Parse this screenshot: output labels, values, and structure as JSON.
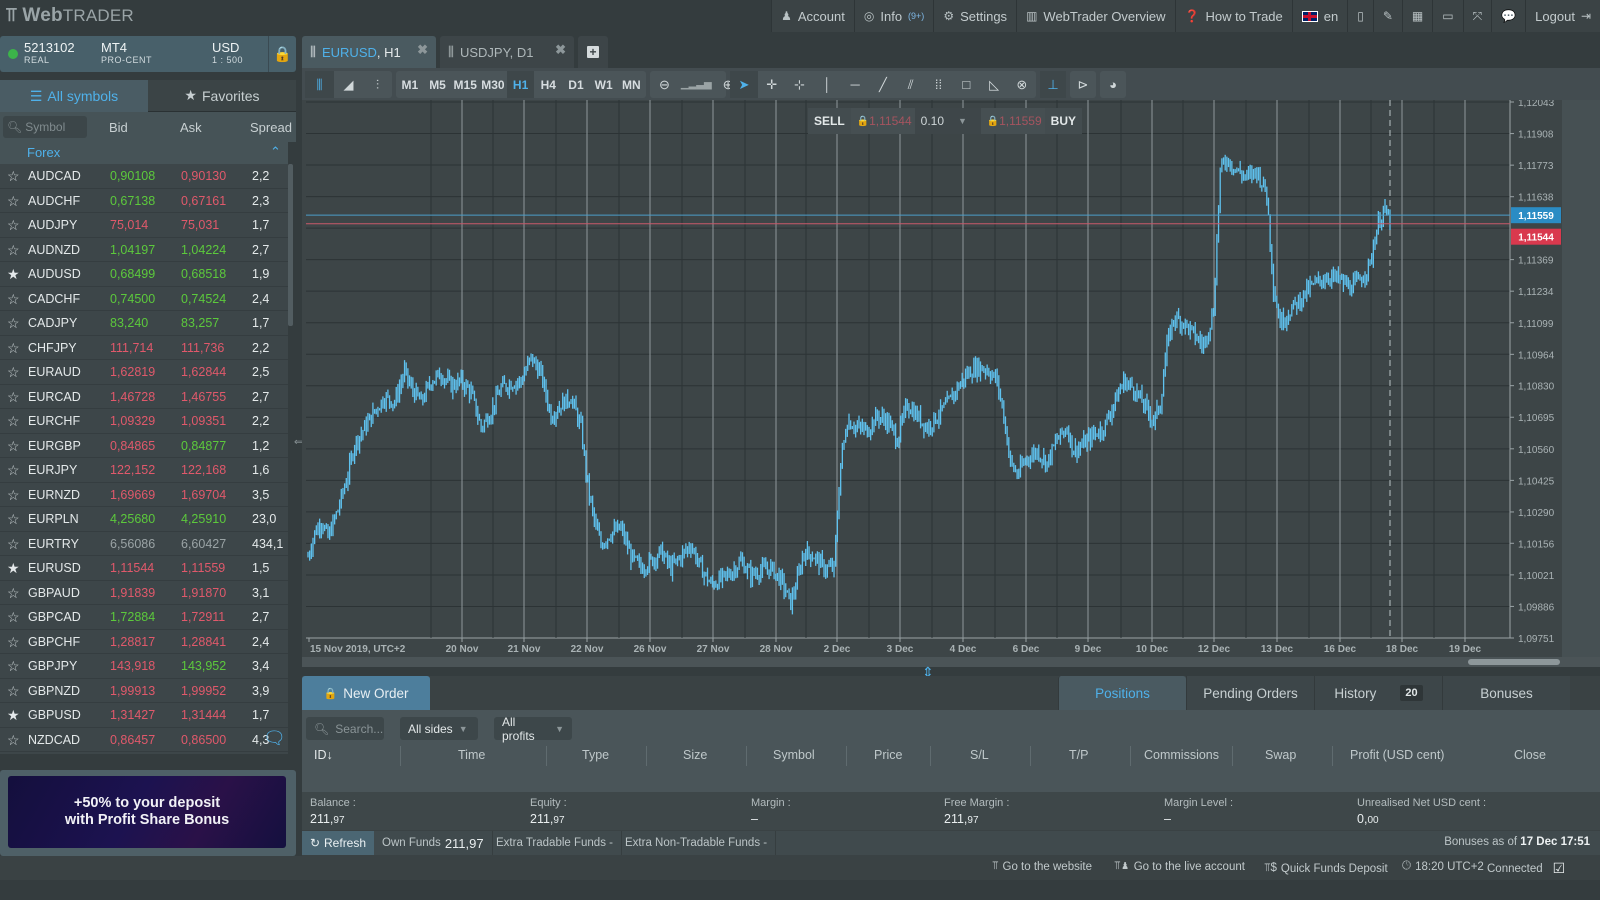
{
  "app": {
    "logo_bold": "Web",
    "logo_light": "TRADER"
  },
  "topmenu": [
    {
      "icon": "user-icon",
      "glyph": "♟",
      "label": "Account"
    },
    {
      "icon": "lifebuoy-icon",
      "glyph": "◎",
      "label": "Info",
      "badge": "(9+)"
    },
    {
      "icon": "gears-icon",
      "glyph": "⚙",
      "label": "Settings"
    },
    {
      "icon": "book-icon",
      "glyph": "▥",
      "label": "WebTrader Overview"
    },
    {
      "icon": "question-icon",
      "glyph": "❓",
      "label": "How to Trade"
    },
    {
      "icon": "uk-flag-icon",
      "glyph": "",
      "label": "en"
    },
    {
      "icon": "mobile-icon",
      "glyph": "▯",
      "label": ""
    },
    {
      "icon": "brush-icon",
      "glyph": "✎",
      "label": ""
    },
    {
      "icon": "grid-icon",
      "glyph": "▦",
      "label": ""
    },
    {
      "icon": "window-icon",
      "glyph": "▭",
      "label": ""
    },
    {
      "icon": "fullscreen-icon",
      "glyph": "⤧",
      "label": ""
    },
    {
      "icon": "chat-icon",
      "glyph": "💬",
      "label": ""
    },
    {
      "icon": "logout-icon",
      "glyph": "⇥",
      "label": "Logout"
    }
  ],
  "account": {
    "number": "5213102",
    "type": "REAL",
    "platform": "MT4",
    "subtype": "PRO-CENT",
    "currency": "USD",
    "leverage": "1 : 500",
    "status_color": "#3cb44a"
  },
  "symbols_panel": {
    "tabs": [
      {
        "label": "All symbols",
        "active": true
      },
      {
        "label": "Favorites",
        "active": false
      }
    ],
    "search_placeholder": "Symbol",
    "columns": [
      "Bid",
      "Ask",
      "Spread"
    ],
    "group": "Forex",
    "rows": [
      {
        "symbol": "AUDCAD",
        "bid": "0,90108",
        "ask": "0,90130",
        "spread": "2,2",
        "fav": false,
        "bid_dir": "up",
        "ask_dir": "dn"
      },
      {
        "symbol": "AUDCHF",
        "bid": "0,67138",
        "ask": "0,67161",
        "spread": "2,3",
        "fav": false,
        "bid_dir": "up",
        "ask_dir": "dn"
      },
      {
        "symbol": "AUDJPY",
        "bid": "75,014",
        "ask": "75,031",
        "spread": "1,7",
        "fav": false,
        "bid_dir": "dn",
        "ask_dir": "dn"
      },
      {
        "symbol": "AUDNZD",
        "bid": "1,04197",
        "ask": "1,04224",
        "spread": "2,7",
        "fav": false,
        "bid_dir": "up",
        "ask_dir": "up"
      },
      {
        "symbol": "AUDUSD",
        "bid": "0,68499",
        "ask": "0,68518",
        "spread": "1,9",
        "fav": true,
        "bid_dir": "up",
        "ask_dir": "up"
      },
      {
        "symbol": "CADCHF",
        "bid": "0,74500",
        "ask": "0,74524",
        "spread": "2,4",
        "fav": false,
        "bid_dir": "up",
        "ask_dir": "up"
      },
      {
        "symbol": "CADJPY",
        "bid": "83,240",
        "ask": "83,257",
        "spread": "1,7",
        "fav": false,
        "bid_dir": "up",
        "ask_dir": "up"
      },
      {
        "symbol": "CHFJPY",
        "bid": "111,714",
        "ask": "111,736",
        "spread": "2,2",
        "fav": false,
        "bid_dir": "dn",
        "ask_dir": "dn"
      },
      {
        "symbol": "EURAUD",
        "bid": "1,62819",
        "ask": "1,62844",
        "spread": "2,5",
        "fav": false,
        "bid_dir": "dn",
        "ask_dir": "dn"
      },
      {
        "symbol": "EURCAD",
        "bid": "1,46728",
        "ask": "1,46755",
        "spread": "2,7",
        "fav": false,
        "bid_dir": "dn",
        "ask_dir": "dn"
      },
      {
        "symbol": "EURCHF",
        "bid": "1,09329",
        "ask": "1,09351",
        "spread": "2,2",
        "fav": false,
        "bid_dir": "dn",
        "ask_dir": "dn"
      },
      {
        "symbol": "EURGBP",
        "bid": "0,84865",
        "ask": "0,84877",
        "spread": "1,2",
        "fav": false,
        "bid_dir": "dn",
        "ask_dir": "up"
      },
      {
        "symbol": "EURJPY",
        "bid": "122,152",
        "ask": "122,168",
        "spread": "1,6",
        "fav": false,
        "bid_dir": "dn",
        "ask_dir": "dn"
      },
      {
        "symbol": "EURNZD",
        "bid": "1,69669",
        "ask": "1,69704",
        "spread": "3,5",
        "fav": false,
        "bid_dir": "dn",
        "ask_dir": "dn"
      },
      {
        "symbol": "EURPLN",
        "bid": "4,25680",
        "ask": "4,25910",
        "spread": "23,0",
        "fav": false,
        "bid_dir": "up",
        "ask_dir": "up"
      },
      {
        "symbol": "EURTRY",
        "bid": "6,56086",
        "ask": "6,60427",
        "spread": "434,1",
        "fav": false,
        "bid_dir": "gr",
        "ask_dir": "gr"
      },
      {
        "symbol": "EURUSD",
        "bid": "1,11544",
        "ask": "1,11559",
        "spread": "1,5",
        "fav": true,
        "bid_dir": "dn",
        "ask_dir": "dn"
      },
      {
        "symbol": "GBPAUD",
        "bid": "1,91839",
        "ask": "1,91870",
        "spread": "3,1",
        "fav": false,
        "bid_dir": "dn",
        "ask_dir": "dn"
      },
      {
        "symbol": "GBPCAD",
        "bid": "1,72884",
        "ask": "1,72911",
        "spread": "2,7",
        "fav": false,
        "bid_dir": "up",
        "ask_dir": "dn"
      },
      {
        "symbol": "GBPCHF",
        "bid": "1,28817",
        "ask": "1,28841",
        "spread": "2,4",
        "fav": false,
        "bid_dir": "dn",
        "ask_dir": "dn"
      },
      {
        "symbol": "GBPJPY",
        "bid": "143,918",
        "ask": "143,952",
        "spread": "3,4",
        "fav": false,
        "bid_dir": "dn",
        "ask_dir": "up"
      },
      {
        "symbol": "GBPNZD",
        "bid": "1,99913",
        "ask": "1,99952",
        "spread": "3,9",
        "fav": false,
        "bid_dir": "dn",
        "ask_dir": "dn"
      },
      {
        "symbol": "GBPUSD",
        "bid": "1,31427",
        "ask": "1,31444",
        "spread": "1,7",
        "fav": true,
        "bid_dir": "dn",
        "ask_dir": "dn"
      },
      {
        "symbol": "NZDCAD",
        "bid": "0,86457",
        "ask": "0,86500",
        "spread": "4,3",
        "fav": false,
        "bid_dir": "dn",
        "ask_dir": "dn"
      }
    ],
    "banner_line1": "+50% to your deposit",
    "banner_line2": "with Profit Share Bonus"
  },
  "chart_tabs": [
    {
      "symbol": "EURUSD",
      "tf": "H1",
      "active": true
    },
    {
      "symbol": "USDJPY",
      "tf": "D1",
      "active": false
    }
  ],
  "chart_toolbar": {
    "chart_types": [
      "bars-icon",
      "area-icon",
      "ohlc-icon"
    ],
    "timeframes": [
      "M1",
      "M5",
      "M15",
      "M30",
      "H1",
      "H4",
      "D1",
      "W1",
      "MN"
    ],
    "active_timeframe": "H1",
    "tools": [
      "cursor-icon",
      "crosshair-icon",
      "crosshair-box-icon",
      "vertical-line-icon",
      "horizontal-line-icon",
      "trend-line-icon",
      "fibonacci-fan-icon",
      "fibonacci-grid-icon",
      "rectangle-icon",
      "triangle-icon",
      "delete-drawings-icon",
      "period-separator-icon",
      "chart-shift-icon",
      "indicators-icon"
    ]
  },
  "trade_box": {
    "sell_label": "SELL",
    "sell_price": "1,11544",
    "volume": "0.10",
    "buy_price": "1,11559",
    "buy_label": "BUY"
  },
  "chart_data": {
    "type": "ohlc",
    "symbol": "EURUSD",
    "timeframe": "H1",
    "y_ticks": [
      "1,12043",
      "1,11908",
      "1,11773",
      "1,11638",
      "1,11369",
      "1,11234",
      "1,11099",
      "1,10964",
      "1,10830",
      "1,10695",
      "1,10560",
      "1,10425",
      "1,10290",
      "1,10156",
      "1,10021",
      "1,09886",
      "1,09751"
    ],
    "ylim": [
      1.09751,
      1.12043
    ],
    "x_ticks": [
      "15 Nov 2019, UTC+2",
      "20 Nov",
      "21 Nov",
      "22 Nov",
      "26 Nov",
      "27 Nov",
      "28 Nov",
      "2 Dec",
      "3 Dec",
      "4 Dec",
      "6 Dec",
      "9 Dec",
      "10 Dec",
      "12 Dec",
      "13 Dec",
      "16 Dec",
      "18 Dec",
      "19 Dec"
    ],
    "ask_price": 1.11559,
    "bid_price": 1.11544,
    "ask_label": "1,11559",
    "bid_label": "1,11544",
    "ask_color": "#2b8cc4",
    "bid_color": "#d9394e",
    "series_color": "#5fc2ef",
    "close_path": [
      [
        0,
        1.101
      ],
      [
        2,
        1.102
      ],
      [
        4,
        1.1025
      ],
      [
        6,
        1.1018
      ],
      [
        9,
        1.103
      ],
      [
        12,
        1.1045
      ],
      [
        14,
        1.1058
      ],
      [
        17,
        1.1065
      ],
      [
        20,
        1.1072
      ],
      [
        23,
        1.1078
      ],
      [
        26,
        1.1076
      ],
      [
        29,
        1.1089
      ],
      [
        31,
        1.1082
      ],
      [
        34,
        1.1076
      ],
      [
        37,
        1.1085
      ],
      [
        40,
        1.1088
      ],
      [
        43,
        1.1083
      ],
      [
        46,
        1.1085
      ],
      [
        49,
        1.108
      ],
      [
        52,
        1.1065
      ],
      [
        55,
        1.1072
      ],
      [
        58,
        1.1082
      ],
      [
        61,
        1.1084
      ],
      [
        64,
        1.1085
      ],
      [
        67,
        1.1095
      ],
      [
        70,
        1.1088
      ],
      [
        73,
        1.107
      ],
      [
        76,
        1.1075
      ],
      [
        79,
        1.1078
      ],
      [
        82,
        1.1065
      ],
      [
        84,
        1.104
      ],
      [
        86,
        1.1025
      ],
      [
        88,
        1.1015
      ],
      [
        91,
        1.102
      ],
      [
        94,
        1.1022
      ],
      [
        97,
        1.101
      ],
      [
        100,
        1.1005
      ],
      [
        103,
        1.1008
      ],
      [
        106,
        1.1012
      ],
      [
        109,
        1.1005
      ],
      [
        112,
        1.101
      ],
      [
        115,
        1.1015
      ],
      [
        118,
        1.1005
      ],
      [
        121,
        1.0998
      ],
      [
        124,
        1.1
      ],
      [
        127,
        1.1003
      ],
      [
        130,
        1.1008
      ],
      [
        133,
        1.1002
      ],
      [
        136,
        1.1004
      ],
      [
        139,
        1.1005
      ],
      [
        142,
        1.1
      ],
      [
        145,
        1.099
      ],
      [
        147,
        1.1
      ],
      [
        149,
        1.1012
      ],
      [
        152,
        1.101
      ],
      [
        155,
        1.1005
      ],
      [
        158,
        1.1005
      ],
      [
        160,
        1.105
      ],
      [
        162,
        1.1068
      ],
      [
        165,
        1.1065
      ],
      [
        168,
        1.1064
      ],
      [
        171,
        1.107
      ],
      [
        174,
        1.1068
      ],
      [
        177,
        1.106
      ],
      [
        180,
        1.1075
      ],
      [
        183,
        1.107
      ],
      [
        186,
        1.1065
      ],
      [
        189,
        1.107
      ],
      [
        192,
        1.1075
      ],
      [
        195,
        1.1082
      ],
      [
        198,
        1.1088
      ],
      [
        201,
        1.1091
      ],
      [
        204,
        1.109
      ],
      [
        207,
        1.1085
      ],
      [
        209,
        1.107
      ],
      [
        211,
        1.105
      ],
      [
        213,
        1.1045
      ],
      [
        216,
        1.1052
      ],
      [
        219,
        1.1055
      ],
      [
        222,
        1.105
      ],
      [
        225,
        1.106
      ],
      [
        228,
        1.1065
      ],
      [
        230,
        1.1055
      ],
      [
        233,
        1.1058
      ],
      [
        236,
        1.1062
      ],
      [
        239,
        1.1065
      ],
      [
        242,
        1.1075
      ],
      [
        245,
        1.1085
      ],
      [
        248,
        1.1082
      ],
      [
        251,
        1.1075
      ],
      [
        254,
        1.1068
      ],
      [
        256,
        1.1075
      ],
      [
        258,
        1.11
      ],
      [
        260,
        1.1112
      ],
      [
        263,
        1.111
      ],
      [
        266,
        1.1105
      ],
      [
        269,
        1.11
      ],
      [
        272,
        1.1115
      ],
      [
        274,
        1.1175
      ],
      [
        276,
        1.118
      ],
      [
        279,
        1.1175
      ],
      [
        282,
        1.1172
      ],
      [
        285,
        1.1175
      ],
      [
        288,
        1.1165
      ],
      [
        290,
        1.1125
      ],
      [
        292,
        1.111
      ],
      [
        295,
        1.1115
      ],
      [
        298,
        1.112
      ],
      [
        301,
        1.1125
      ],
      [
        304,
        1.1128
      ],
      [
        307,
        1.113
      ],
      [
        310,
        1.1128
      ],
      [
        313,
        1.1125
      ],
      [
        316,
        1.1128
      ],
      [
        319,
        1.1135
      ],
      [
        321,
        1.115
      ],
      [
        323,
        1.1158
      ],
      [
        325,
        1.1154
      ]
    ]
  },
  "bottom": {
    "new_order": "New Order",
    "tabs": [
      {
        "label": "Positions",
        "active": true
      },
      {
        "label": "Pending Orders",
        "active": false
      },
      {
        "label": "History",
        "active": false,
        "badge": "20"
      },
      {
        "label": "Bonuses",
        "active": false
      }
    ],
    "search_placeholder": "Search...",
    "side_filter": "All sides",
    "profit_filter": "All profits",
    "columns": [
      "ID",
      "Time",
      "Type",
      "Size",
      "Symbol",
      "Price",
      "S/L",
      "T/P",
      "Commissions",
      "Swap",
      "Profit (USD cent)",
      "Close"
    ],
    "summary": [
      {
        "label": "Balance :",
        "value": "211,",
        "cents": "97"
      },
      {
        "label": "Equity :",
        "value": "211,",
        "cents": "97"
      },
      {
        "label": "Margin :",
        "value": "–",
        "cents": ""
      },
      {
        "label": "Free Margin :",
        "value": "211,",
        "cents": "97"
      },
      {
        "label": "Margin Level :",
        "value": "–",
        "cents": ""
      },
      {
        "label": "Unrealised Net USD cent :",
        "value": "0,",
        "cents": "00"
      }
    ],
    "refresh": "Refresh",
    "own_funds_label": "Own Funds",
    "own_funds_value": "211,97",
    "extra_tradable": "Extra Tradable Funds -",
    "extra_nontradable": "Extra Non-Tradable Funds -",
    "bonuses_prefix": "Bonuses as of",
    "bonuses_date": "17 Dec 17:51"
  },
  "statusbar": {
    "website": "Go to the website",
    "live_account": "Go to the live account",
    "quick_deposit": "Quick Funds Deposit",
    "time": "18:20 UTC+2",
    "connection": "Connected"
  }
}
